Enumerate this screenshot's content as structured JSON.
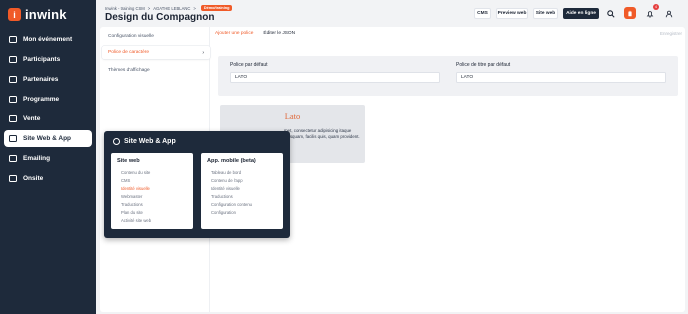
{
  "app": {
    "logo_text": "inwink",
    "logo_glyph": "i"
  },
  "sidebar": {
    "items": [
      {
        "label": "Mon événement",
        "icon": "calendar-icon",
        "active": false
      },
      {
        "label": "Participants",
        "icon": "participants-icon",
        "active": false
      },
      {
        "label": "Partenaires",
        "icon": "partners-icon",
        "active": false
      },
      {
        "label": "Programme",
        "icon": "programme-icon",
        "active": false
      },
      {
        "label": "Vente",
        "icon": "cart-icon",
        "active": false
      },
      {
        "label": "Site Web & App",
        "icon": "globe-icon",
        "active": true
      },
      {
        "label": "Emailing",
        "icon": "mail-icon",
        "active": false
      },
      {
        "label": "Onsite",
        "icon": "onsite-icon",
        "active": false
      }
    ]
  },
  "header": {
    "breadcrumb": [
      "Inwink - training CSM",
      ">",
      "AGATHE LEBLANC",
      ">"
    ],
    "badge": "Démo/training",
    "title": "Design du Compagnon",
    "buttons": {
      "cms": "CMS",
      "preview_web": "Preview web",
      "site_web": "Site web",
      "help": "Aide en ligne"
    },
    "icons": [
      "search-icon",
      "avatar-icon",
      "bell-icon",
      "user-icon"
    ],
    "notification_count": "4"
  },
  "subnav": {
    "items": [
      {
        "label": "Configuration visuelle",
        "active": false
      },
      {
        "label": "Police de caractère",
        "active": true
      },
      {
        "label": "Thèmes d'affichage",
        "active": false
      }
    ]
  },
  "tabs": {
    "add_font": "Ajouter une police",
    "edit_json": "Éditer le JSON",
    "save": "Enregistrer"
  },
  "font_form": {
    "default_label": "Police par défaut",
    "default_value": "LATO",
    "title_label": "Police de titre par défaut",
    "title_value": "LATO"
  },
  "preview": {
    "title": "Lato",
    "text": "met, consectetur adipisicing itaque quisquam, facilis quis, quam provident."
  },
  "dropdown": {
    "heading": "Site Web & App",
    "site_web": {
      "title": "Site web",
      "links": [
        "Contenu du site",
        "CMS",
        "Identité visuelle",
        "Webmaster",
        "Traductions",
        "Plan du site",
        "Activité site web"
      ],
      "active_index": 2
    },
    "app_mobile": {
      "title": "App. mobile (beta)",
      "links": [
        "Tableau de bord",
        "Contenu de l'app",
        "Identité visuelle",
        "Traductions",
        "Configuration contenu",
        "Configuration"
      ]
    }
  },
  "colors": {
    "accent": "#f05a28",
    "sidebar_bg": "#1e2a3b",
    "page_bg": "#f2f3f5"
  }
}
